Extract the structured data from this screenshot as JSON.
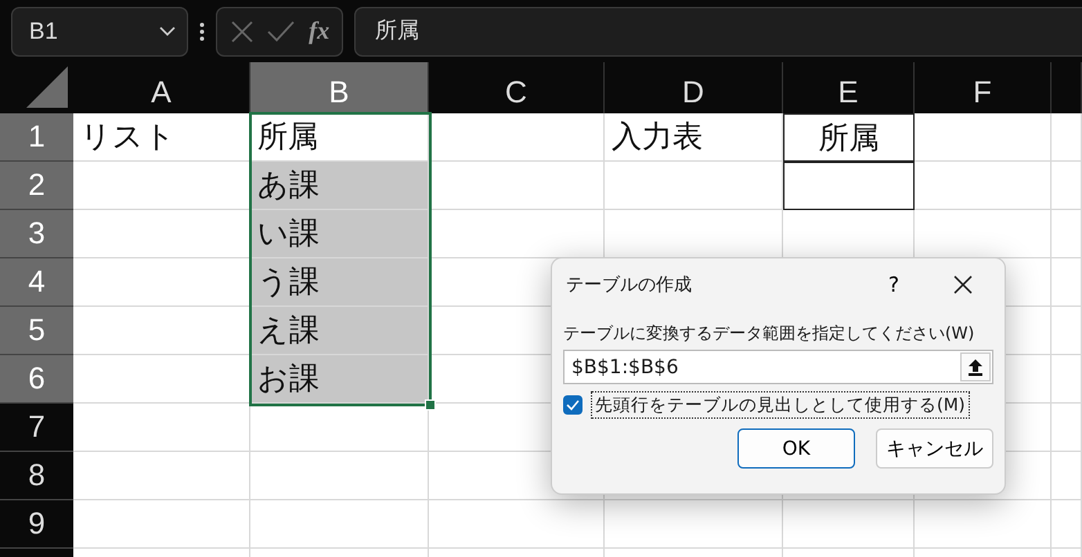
{
  "name_box": {
    "value": "B1"
  },
  "formula_bar": {
    "function_label": "fx",
    "value": "所属"
  },
  "columns": [
    {
      "label": "A",
      "selected": false
    },
    {
      "label": "B",
      "selected": true
    },
    {
      "label": "C",
      "selected": false
    },
    {
      "label": "D",
      "selected": false
    },
    {
      "label": "E",
      "selected": false
    },
    {
      "label": "F",
      "selected": false
    }
  ],
  "rows": [
    {
      "label": "1",
      "selected": true,
      "cells": {
        "A": {
          "text": "リスト"
        },
        "B": {
          "text": "所属",
          "selected": true,
          "active": true
        },
        "D": {
          "text": "入力表"
        },
        "E": {
          "text": "所属",
          "bordered": true,
          "centered": true
        }
      }
    },
    {
      "label": "2",
      "selected": true,
      "cells": {
        "B": {
          "text": "あ課",
          "selected": true
        },
        "E": {
          "bordered": true
        }
      }
    },
    {
      "label": "3",
      "selected": true,
      "cells": {
        "B": {
          "text": "い課",
          "selected": true
        }
      }
    },
    {
      "label": "4",
      "selected": true,
      "cells": {
        "B": {
          "text": "う課",
          "selected": true
        }
      }
    },
    {
      "label": "5",
      "selected": true,
      "cells": {
        "B": {
          "text": "え課",
          "selected": true
        }
      }
    },
    {
      "label": "6",
      "selected": true,
      "cells": {
        "B": {
          "text": "お課",
          "selected": true
        }
      }
    },
    {
      "label": "7",
      "selected": false,
      "cells": {}
    },
    {
      "label": "8",
      "selected": false,
      "cells": {}
    },
    {
      "label": "9",
      "selected": false,
      "cells": {}
    }
  ],
  "dialog": {
    "title": "テーブルの作成",
    "help": "?",
    "range_label": "テーブルに変換するデータ範囲を指定してください(W)",
    "range_value": "$B$1:$B$6",
    "header_checkbox": {
      "label": "先頭行をテーブルの見出しとして使用する(M)",
      "checked": true
    },
    "buttons": [
      {
        "label": "OK",
        "default": true
      },
      {
        "label": "キャンセル",
        "default": false
      }
    ]
  }
}
